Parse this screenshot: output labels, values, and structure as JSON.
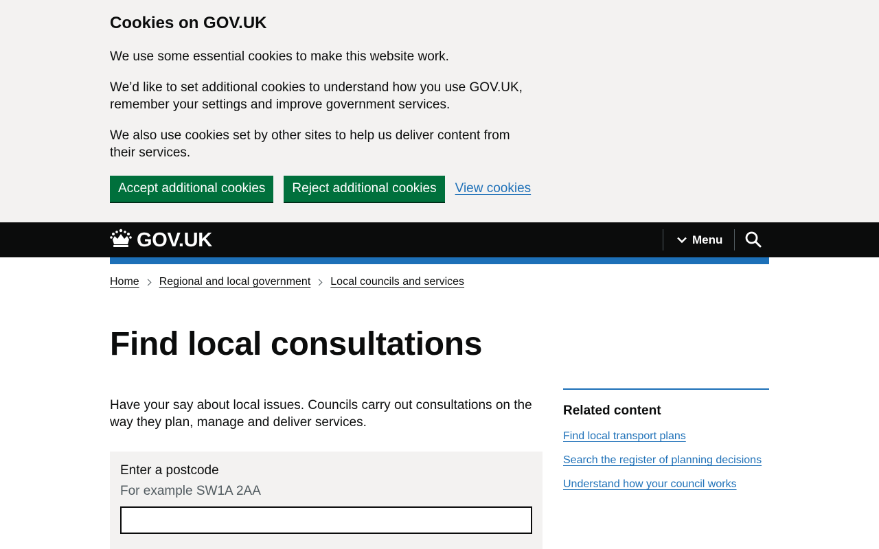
{
  "cookie_banner": {
    "title": "Cookies on GOV.UK",
    "paragraphs": [
      "We use some essential cookies to make this website work.",
      "We’d like to set additional cookies to understand how you use GOV.UK, remember your settings and improve government services.",
      "We also use cookies set by other sites to help us deliver content from their services."
    ],
    "accept_label": "Accept additional cookies",
    "reject_label": "Reject additional cookies",
    "view_label": "View cookies"
  },
  "header": {
    "logo_text": "GOV.UK",
    "menu_label": "Menu",
    "search_icon": "search-icon",
    "menu_icon": "chevron-down-icon",
    "logo_icon": "crown-icon"
  },
  "breadcrumbs": [
    "Home",
    "Regional and local government",
    "Local councils and services"
  ],
  "main": {
    "title": "Find local consultations",
    "intro": "Have your say about local issues. Councils carry out consultations on the way they plan, manage and deliver services.",
    "postcode_label": "Enter a postcode",
    "postcode_hint": "For example SW1A 2AA",
    "postcode_value": ""
  },
  "related": {
    "title": "Related content",
    "links": [
      "Find local transport plans",
      "Search the register of planning decisions",
      "Understand how your council works"
    ]
  },
  "colors": {
    "banner_bg": "#f3f2f1",
    "header_bg": "#0b0c0c",
    "brand_blue": "#1d70b8",
    "button_green": "#00703c",
    "text": "#0b0c0c",
    "hint": "#505a5f"
  }
}
